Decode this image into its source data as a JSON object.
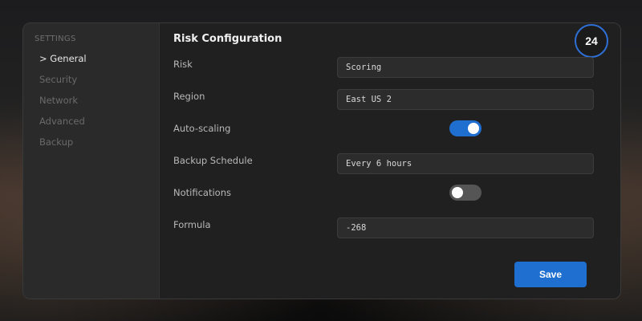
{
  "sidebar": {
    "heading": "SETTINGS",
    "items": [
      {
        "label": "> General",
        "active": true
      },
      {
        "label": "Security",
        "active": false
      },
      {
        "label": "Network",
        "active": false
      },
      {
        "label": "Advanced",
        "active": false
      },
      {
        "label": "Backup",
        "active": false
      }
    ]
  },
  "main": {
    "title": "Risk Configuration",
    "badge": "24",
    "fields": {
      "risk": {
        "label": "Risk",
        "value": "Scoring"
      },
      "region": {
        "label": "Region",
        "value": "East US 2"
      },
      "autoscaling": {
        "label": "Auto-scaling",
        "enabled": true
      },
      "backup_schedule": {
        "label": "Backup Schedule",
        "value": "Every 6 hours"
      },
      "notifications": {
        "label": "Notifications",
        "enabled": false
      },
      "formula": {
        "label": "Formula",
        "value": "-268"
      }
    },
    "save_label": "Save"
  },
  "colors": {
    "accent": "#1e6fd0",
    "badge_ring": "#2e6fd6"
  }
}
